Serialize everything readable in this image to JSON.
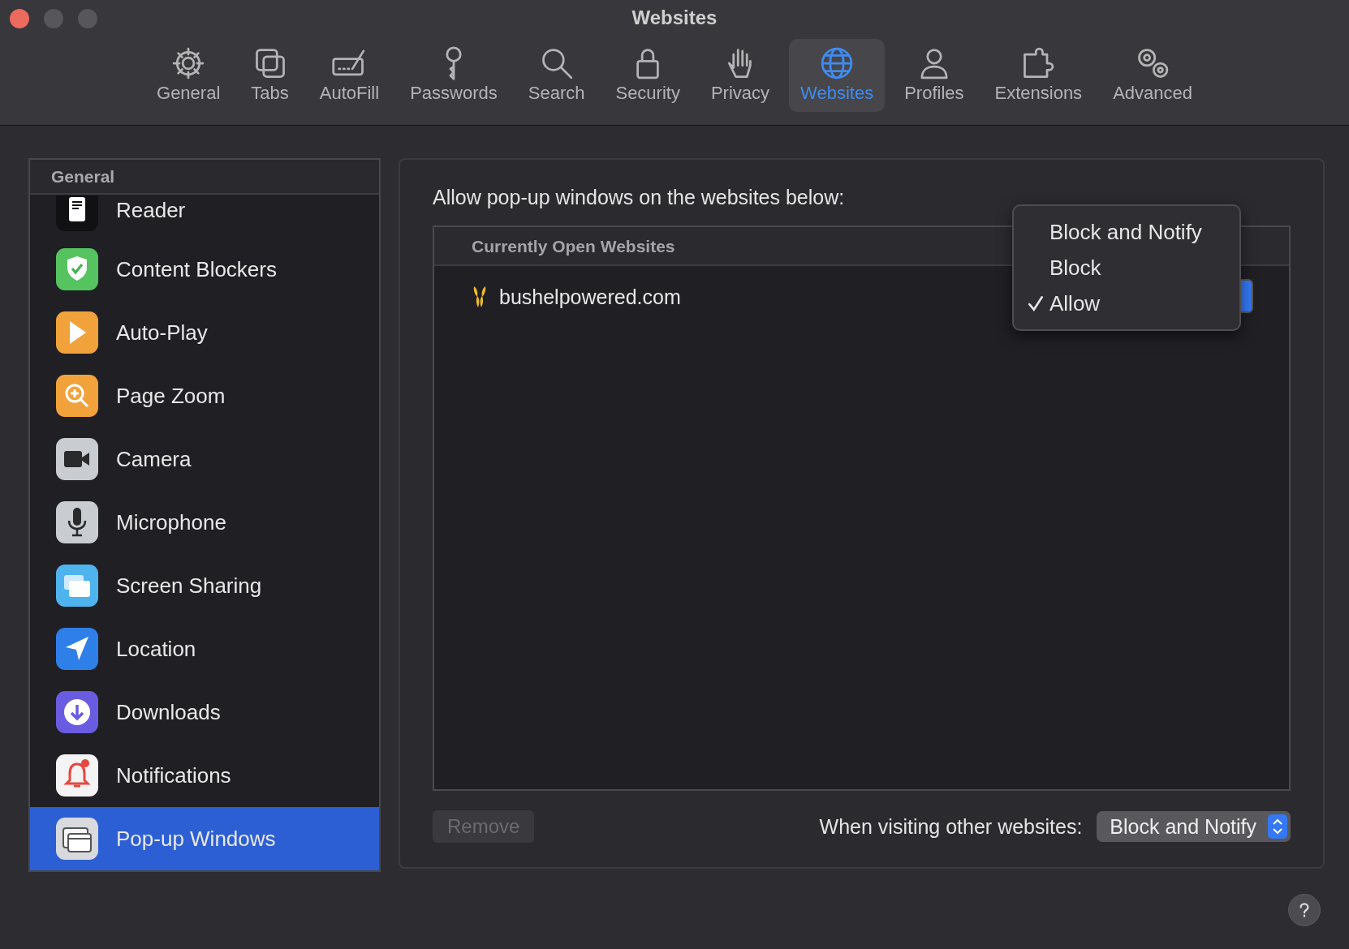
{
  "window": {
    "title": "Websites"
  },
  "toolbar": [
    {
      "label": "General",
      "selected": false
    },
    {
      "label": "Tabs",
      "selected": false
    },
    {
      "label": "AutoFill",
      "selected": false
    },
    {
      "label": "Passwords",
      "selected": false
    },
    {
      "label": "Search",
      "selected": false
    },
    {
      "label": "Security",
      "selected": false
    },
    {
      "label": "Privacy",
      "selected": false
    },
    {
      "label": "Websites",
      "selected": true
    },
    {
      "label": "Profiles",
      "selected": false
    },
    {
      "label": "Extensions",
      "selected": false
    },
    {
      "label": "Advanced",
      "selected": false
    }
  ],
  "sidebar": {
    "header": "General",
    "items": [
      {
        "label": "Reader",
        "selected": false
      },
      {
        "label": "Content Blockers",
        "selected": false
      },
      {
        "label": "Auto-Play",
        "selected": false
      },
      {
        "label": "Page Zoom",
        "selected": false
      },
      {
        "label": "Camera",
        "selected": false
      },
      {
        "label": "Microphone",
        "selected": false
      },
      {
        "label": "Screen Sharing",
        "selected": false
      },
      {
        "label": "Location",
        "selected": false
      },
      {
        "label": "Downloads",
        "selected": false
      },
      {
        "label": "Notifications",
        "selected": false
      },
      {
        "label": "Pop-up Windows",
        "selected": true
      }
    ]
  },
  "panel": {
    "heading": "Allow pop-up windows on the websites below:",
    "table": {
      "section": "Currently Open Websites",
      "rows": [
        {
          "site": "bushelpowered.com"
        }
      ]
    },
    "menu": [
      {
        "label": "Block and Notify",
        "selected": false
      },
      {
        "label": "Block",
        "selected": false
      },
      {
        "label": "Allow",
        "selected": true
      }
    ],
    "remove_button": {
      "label": "Remove",
      "disabled": true
    },
    "other_label": "When visiting other websites:",
    "other_value": "Block and Notify"
  }
}
